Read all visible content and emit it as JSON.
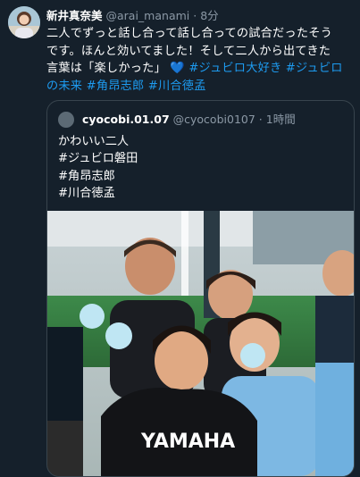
{
  "tweet": {
    "author_name": "新井真奈美",
    "handle": "@arai_manami",
    "separator": "·",
    "time": "8分",
    "text_line1": "二人でずっと話し合って話し合っての試合だったそう",
    "text_line2": "です。ほんと効いてました！そして二人から出てきた",
    "text_line3_a": "言葉は「楽しかった」",
    "heart": "💙",
    "hashtag1": "#ジュビロ大好き",
    "hashtag2": "#ジュビロ",
    "hashtag2_cont": "の未来",
    "hashtag3": "#角昂志郎",
    "hashtag4": "#川合徳孟"
  },
  "quote": {
    "author_name": "cyocobi.01.07",
    "handle": "@cyocobi0107",
    "separator": "·",
    "time": "1時間",
    "lines": [
      "かわいい二人",
      "#ジュビロ磐田",
      "#角昂志郎",
      "#川合徳孟"
    ],
    "photo_text": "YAMAHA"
  },
  "colors": {
    "background": "#15202b",
    "text": "#ffffff",
    "muted": "#8b98a5",
    "link": "#1d9bf0",
    "border": "#38444d"
  },
  "icons": [
    "avatar",
    "quote-avatar",
    "blue-heart-emoji"
  ]
}
